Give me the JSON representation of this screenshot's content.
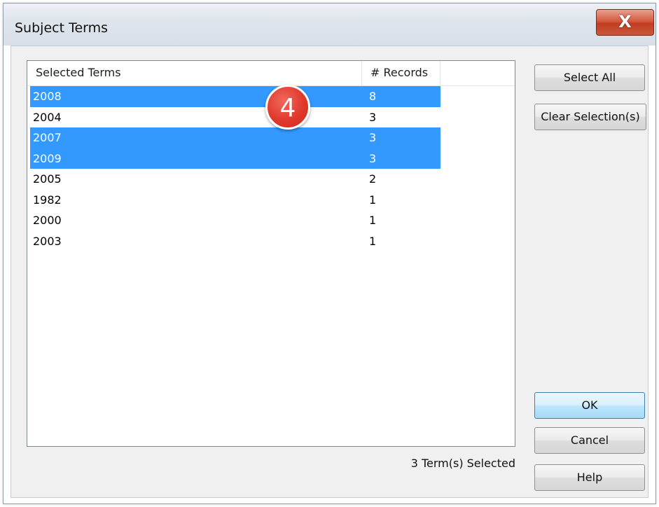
{
  "window": {
    "title": "Subject Terms",
    "close_glyph": "X"
  },
  "table": {
    "columns": [
      "Selected Terms",
      "# Records"
    ],
    "rows": [
      {
        "term": "2008",
        "records": "8",
        "selected": true
      },
      {
        "term": "2004",
        "records": "3",
        "selected": false
      },
      {
        "term": "2007",
        "records": "3",
        "selected": true
      },
      {
        "term": "2009",
        "records": "3",
        "selected": true
      },
      {
        "term": "2005",
        "records": "2",
        "selected": false
      },
      {
        "term": "1982",
        "records": "1",
        "selected": false
      },
      {
        "term": "2000",
        "records": "1",
        "selected": false
      },
      {
        "term": "2003",
        "records": "1",
        "selected": false
      }
    ]
  },
  "annotation": {
    "step_number": "4",
    "color": "#e0392c"
  },
  "buttons": {
    "select_all": "Select All",
    "clear_selection": "Clear Selection(s)",
    "ok": "OK",
    "cancel": "Cancel",
    "help": "Help"
  },
  "status": {
    "selected_count_text": "3 Term(s) Selected"
  },
  "colors": {
    "selection": "#3399ff",
    "close_button": "#c23e22"
  }
}
